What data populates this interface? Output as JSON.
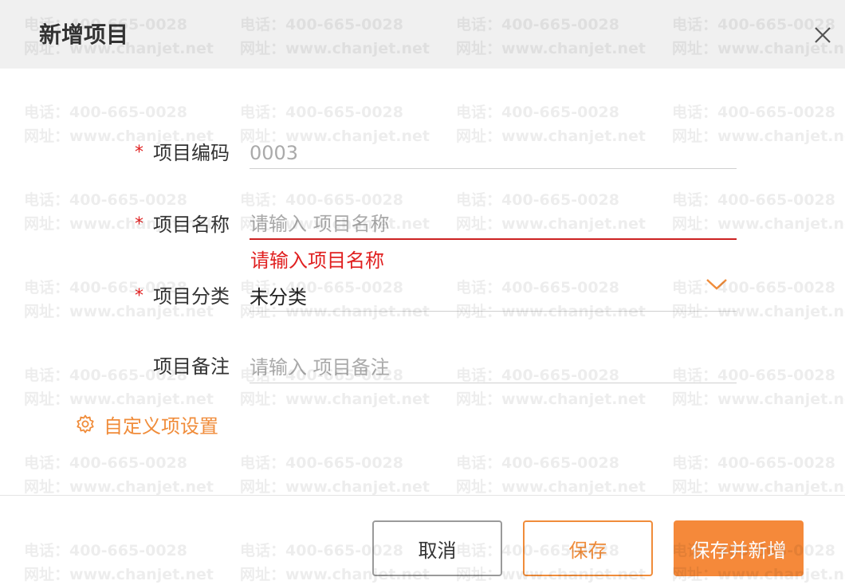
{
  "dialog": {
    "title": "新增项目"
  },
  "form": {
    "code": {
      "label": "项目编码",
      "placeholder": "0003",
      "required_mark": "*"
    },
    "name": {
      "label": "项目名称",
      "placeholder": "请输入 项目名称",
      "required_mark": "*",
      "error": "请输入项目名称"
    },
    "category": {
      "label": "项目分类",
      "value": "未分类",
      "required_mark": "*"
    },
    "remark": {
      "label": "项目备注",
      "placeholder": "请输入 项目备注"
    }
  },
  "custom_settings": {
    "label": "自定义项设置",
    "icon": "gear-icon"
  },
  "footer": {
    "cancel_label": "取消",
    "save_label": "保存",
    "save_new_label": "保存并新增"
  },
  "watermark": {
    "phone": "电话：400-665-0028",
    "website": "网址：www.chanjet.net"
  },
  "colors": {
    "accent": "#f5893a",
    "error": "#e02020",
    "header_bg": "#f0f0f0"
  }
}
